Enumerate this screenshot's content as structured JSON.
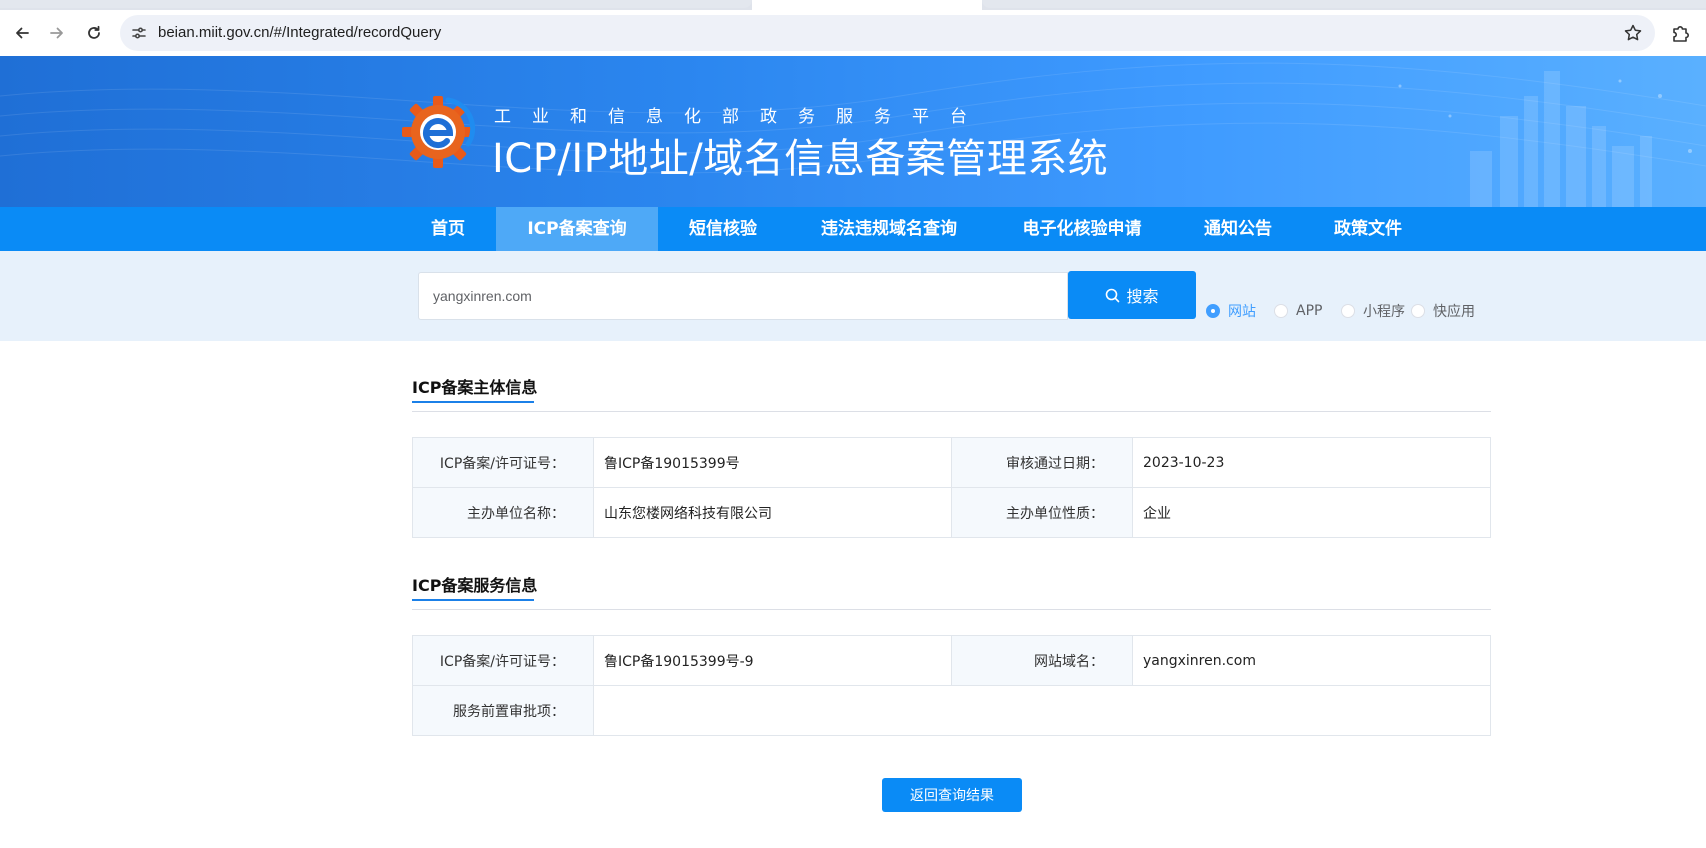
{
  "browser": {
    "url": "beian.miit.gov.cn/#/Integrated/recordQuery",
    "back_icon": "arrow-left-icon",
    "forward_icon": "arrow-right-icon",
    "reload_icon": "reload-icon",
    "site_info_icon": "tune-icon",
    "bookmark_icon": "star-icon",
    "extensions_icon": "puzzle-icon"
  },
  "header": {
    "subtitle": "工业和信息化部政务服务平台",
    "title": "ICP/IP地址/域名信息备案管理系统",
    "logo_icon": "gear-e-logo"
  },
  "nav": {
    "items": [
      {
        "label": "首页"
      },
      {
        "label": "ICP备案查询"
      },
      {
        "label": "短信核验"
      },
      {
        "label": "违法违规域名查询"
      },
      {
        "label": "电子化核验申请"
      },
      {
        "label": "通知公告"
      },
      {
        "label": "政策文件"
      }
    ],
    "active_index": 1
  },
  "search": {
    "value": "yangxinren.com",
    "button_label": "搜索",
    "types": [
      {
        "label": "网站",
        "checked": true
      },
      {
        "label": "APP",
        "checked": false
      },
      {
        "label": "小程序",
        "checked": false
      },
      {
        "label": "快应用",
        "checked": false
      }
    ]
  },
  "subject_info": {
    "title": "ICP备案主体信息",
    "license_label": "ICP备案/许可证号：",
    "license_value": "鲁ICP备19015399号",
    "approval_date_label": "审核通过日期：",
    "approval_date_value": "2023-10-23",
    "org_name_label": "主办单位名称：",
    "org_name_value": "山东您楼网络科技有限公司",
    "org_type_label": "主办单位性质：",
    "org_type_value": "企业"
  },
  "service_info": {
    "title": "ICP备案服务信息",
    "license_label": "ICP备案/许可证号：",
    "license_value": "鲁ICP备19015399号-9",
    "domain_label": "网站域名：",
    "domain_value": "yangxinren.com",
    "pre_approval_label": "服务前置审批项：",
    "pre_approval_value": ""
  },
  "actions": {
    "back_label": "返回查询结果"
  },
  "colors": {
    "primary": "#0a8bf6",
    "nav_active": "#4ea9f7",
    "radio_checked": "#409eff"
  }
}
